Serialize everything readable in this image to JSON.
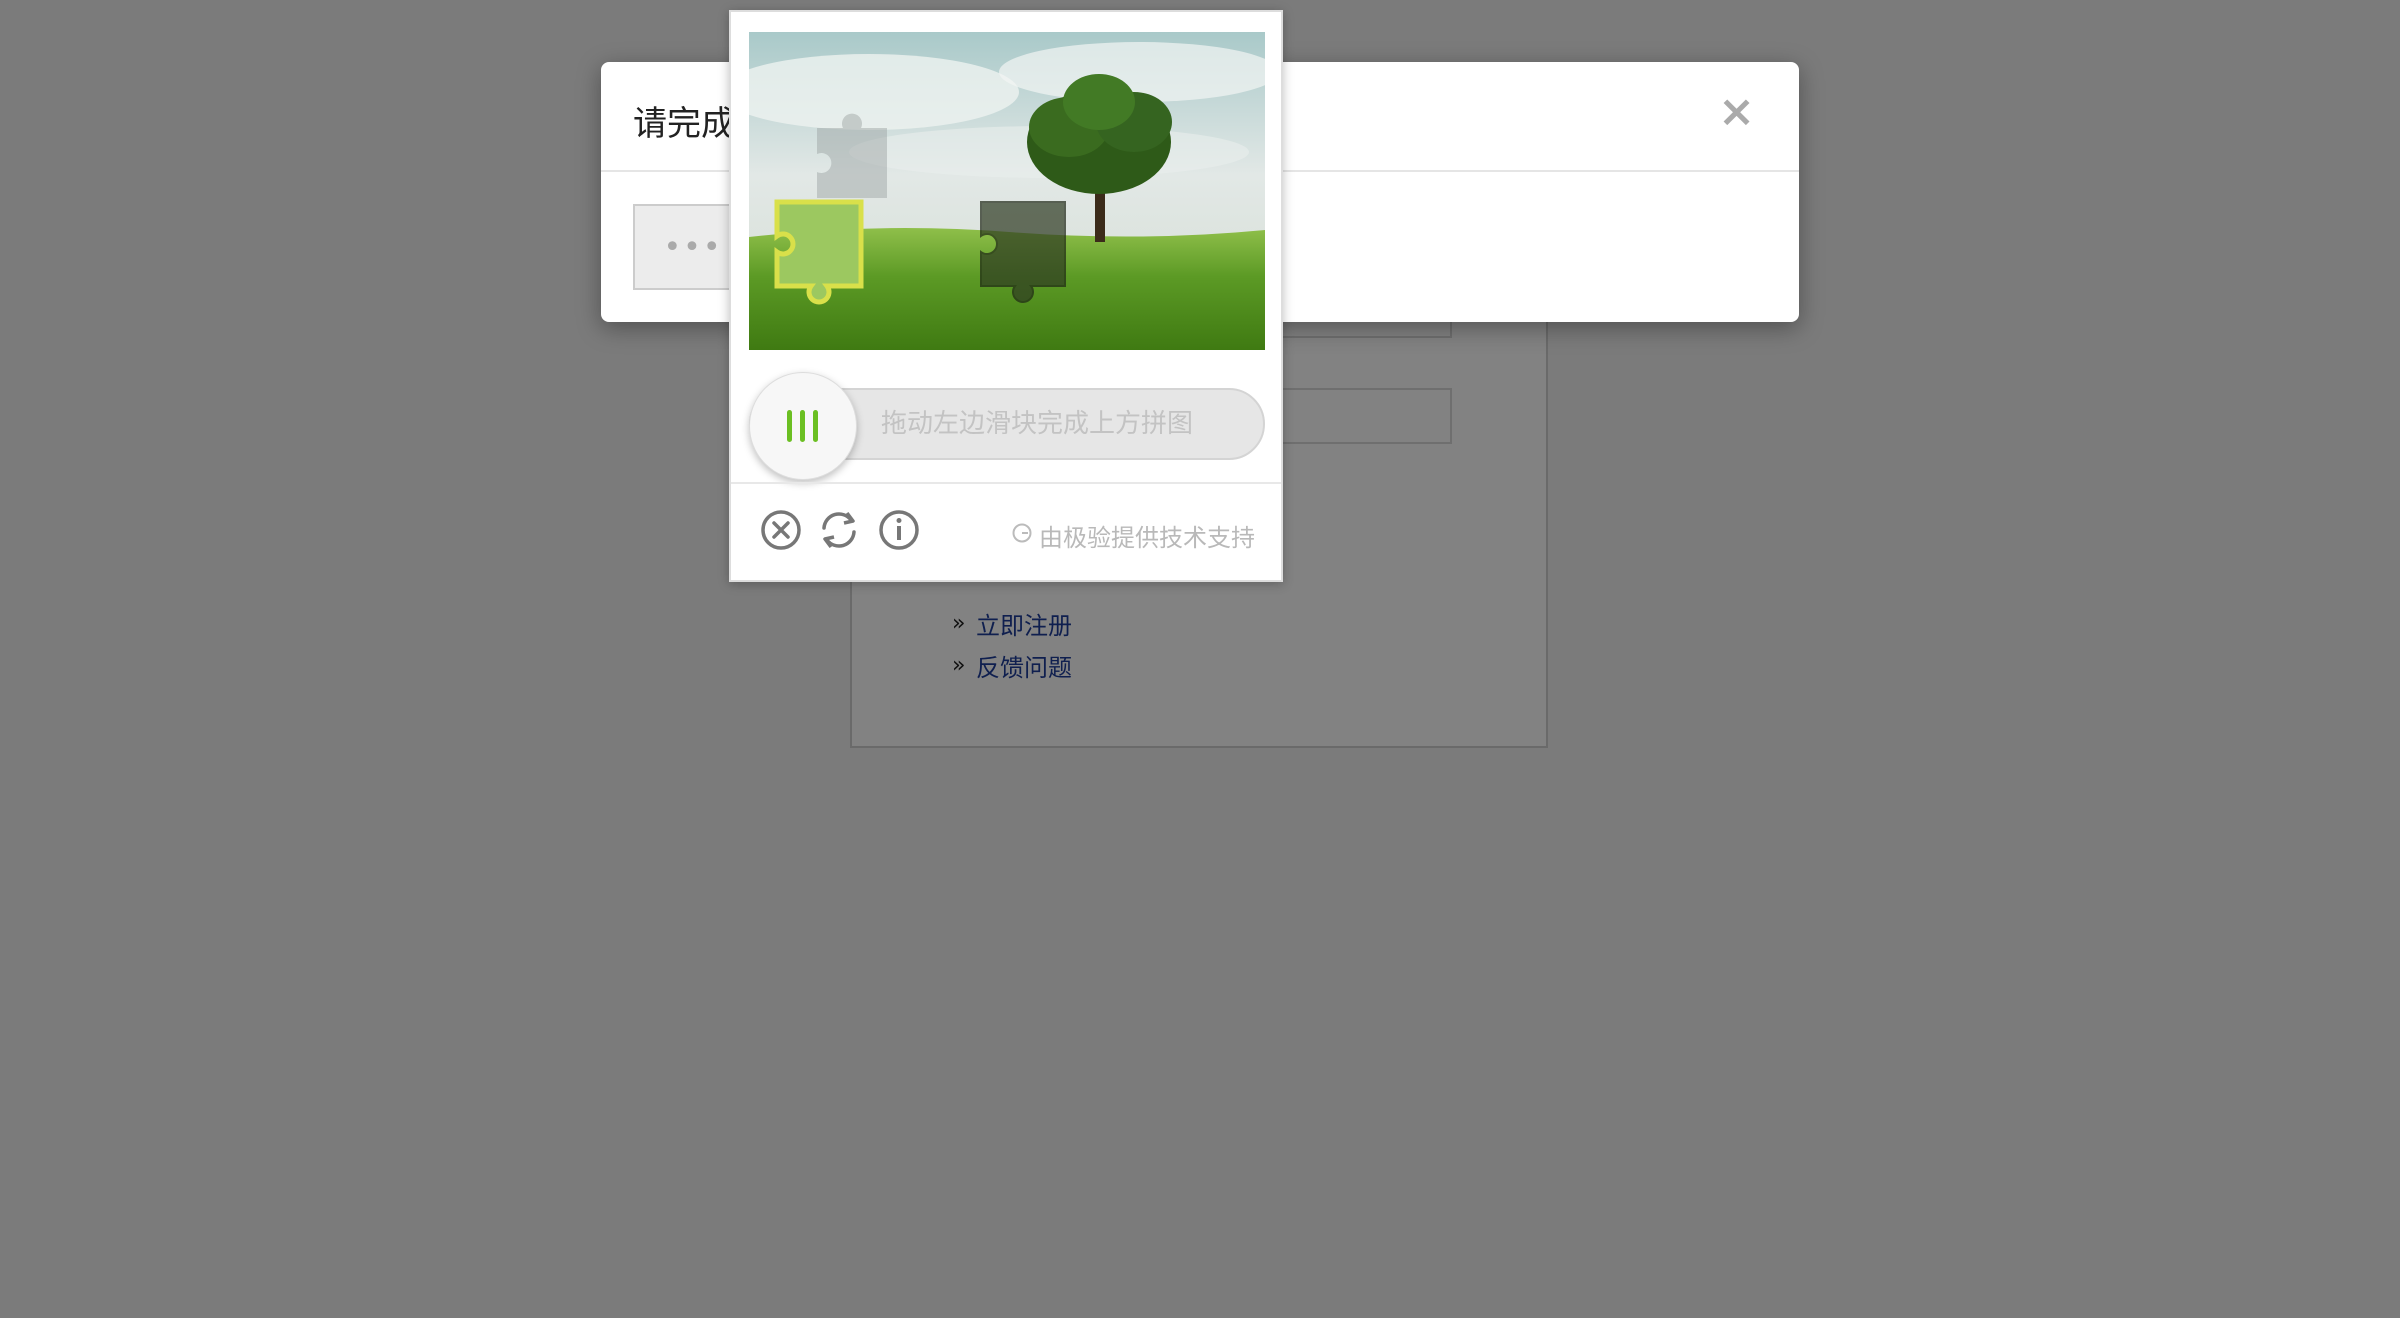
{
  "modal": {
    "title": "请完成",
    "close_glyph": "×",
    "loading_glyph": "•••"
  },
  "background": {
    "links": [
      {
        "marker": "»",
        "label": "立即注册"
      },
      {
        "marker": "»",
        "label": "反馈问题"
      }
    ]
  },
  "captcha": {
    "slider_hint": "拖动左边滑块完成上方拼图",
    "slider_progress": 0,
    "powered_by": "由极验提供技术支持",
    "icons": [
      "close-circle-icon",
      "refresh-icon",
      "info-icon",
      "slider-grip-icon"
    ],
    "accent_color": "#6bbf22"
  }
}
